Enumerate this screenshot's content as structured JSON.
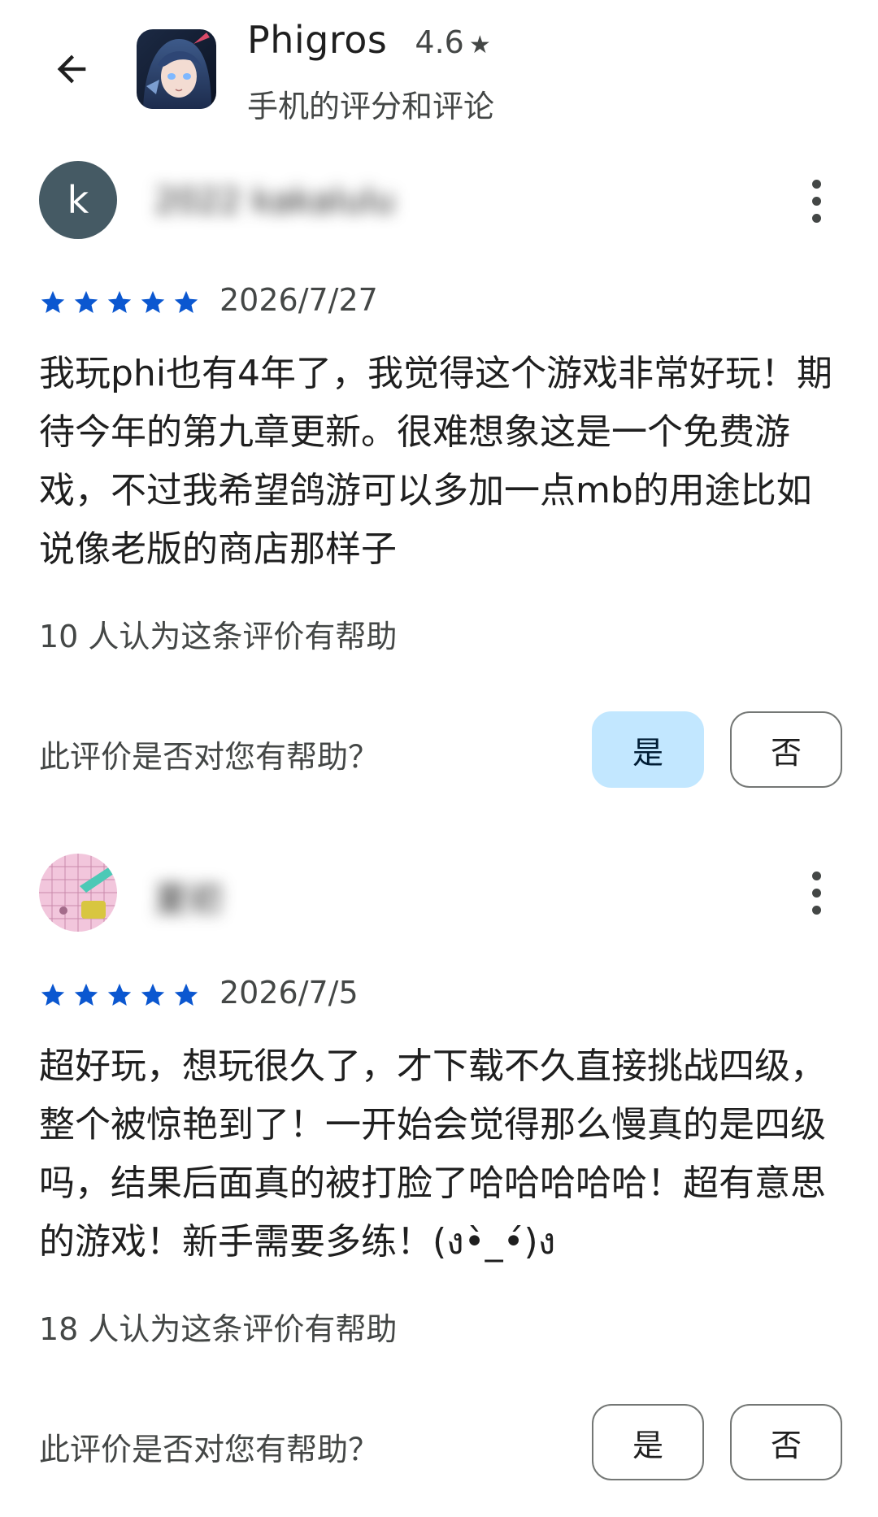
{
  "header": {
    "back_icon": "arrow-back-icon",
    "app_name": "Phigros",
    "rating": "4.6",
    "rating_star": "★",
    "subtitle": "手机的评分和评论"
  },
  "colors": {
    "star": "#0b57d0",
    "selected_button_bg": "#c2e7ff",
    "avatar_bg": "#455a64"
  },
  "reviews": [
    {
      "avatar_letter": "k",
      "reviewer_name": "2022 kakalulu",
      "stars": 5,
      "date": "2026/7/27",
      "text": "我玩phi也有4年了，我觉得这个游戏非常好玩！期待今年的第九章更新。很难想象这是一个免费游戏，不过我希望鸽游可以多加一点mb的用途比如说像老版的商店那样子",
      "helpful_count": "10 人认为这条评价有帮助",
      "helpful_question": "此评价是否对您有帮助？",
      "yes_label": "是",
      "no_label": "否",
      "yes_selected": true
    },
    {
      "avatar_letter": "",
      "reviewer_name": "夏初",
      "stars": 5,
      "date": "2026/7/5",
      "text": "超好玩，想玩很久了，才下载不久直接挑战四级，整个被惊艳到了！一开始会觉得那么慢真的是四级吗，结果后面真的被打脸了哈哈哈哈哈！超有意思的游戏！新手需要多练！(ง•̀_•́)ง",
      "helpful_count": "18 人认为这条评价有帮助",
      "helpful_question": "此评价是否对您有帮助？",
      "yes_label": "是",
      "no_label": "否",
      "yes_selected": false
    }
  ]
}
